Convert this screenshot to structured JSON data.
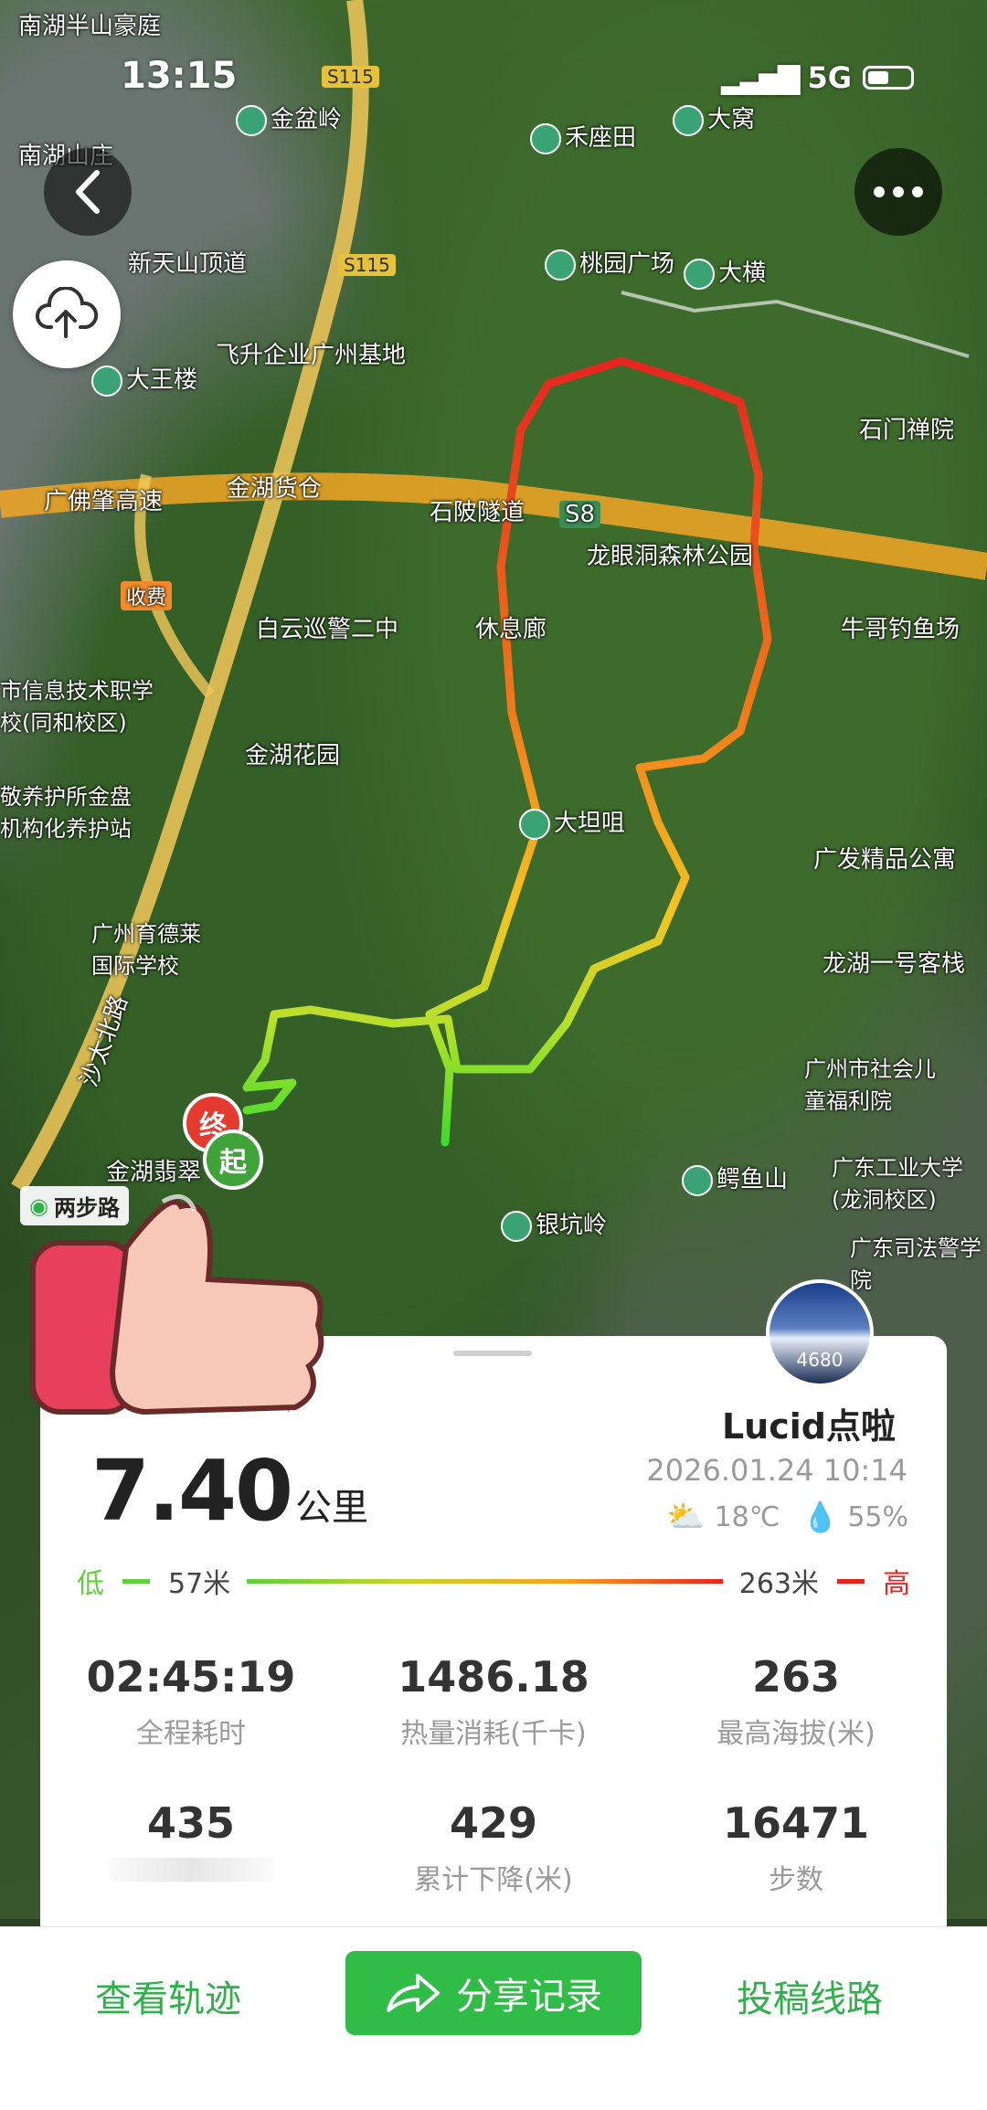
{
  "status_bar": {
    "time": "13:15",
    "network": "5G"
  },
  "map": {
    "route_colors": [
      "#e5261f",
      "#f07a1a",
      "#f4c321",
      "#b6e02a",
      "#3fdc2c"
    ],
    "brand_label": "两步路",
    "start_marker": "起",
    "end_marker": "终",
    "places": [
      "南湖半山豪庭",
      "南湖山庄",
      "金盆岭",
      "禾座田",
      "大窝",
      "新天山顶道",
      "桃园广场",
      "大横",
      "飞升企业广州基地",
      "大王楼",
      "石门禅院",
      "广佛肇高速",
      "金湖货仓",
      "石陂隧道",
      "S8",
      "龙眼洞森林公园",
      "收费",
      "白云巡警二中",
      "休息廊",
      "牛哥钓鱼场",
      "市信息技术职学校(同和校区)",
      "金湖花园",
      "敬养护所金盘机构化养护站",
      "大坦咀",
      "广发精品公寓",
      "广州育德莱国际学校",
      "龙湖一号客栈",
      "沙太北路",
      "广州市社会儿童福利院",
      "金湖翡翠",
      "广东工业大学(龙洞校区)",
      "鳄鱼山",
      "银坑岭",
      "广东司法警学院",
      "S115"
    ]
  },
  "record": {
    "avatar_text": "4680",
    "username": "Lucid点啦",
    "datetime": "2026.01.24 10:14",
    "temperature": "18℃",
    "humidity": "55%",
    "place_partial": "山",
    "distance_value": "7.40",
    "distance_unit": "公里",
    "elevation": {
      "low_label": "低",
      "low_value": "57米",
      "high_value": "263米",
      "high_label": "高"
    },
    "stats": [
      {
        "value": "02:45:19",
        "label": "全程耗时"
      },
      {
        "value": "1486.18",
        "label": "热量消耗(千卡)"
      },
      {
        "value": "263",
        "label": "最高海拔(米)"
      },
      {
        "value": "435",
        "label": ""
      },
      {
        "value": "429",
        "label": "累计下降(米)"
      },
      {
        "value": "16471",
        "label": "步数"
      }
    ]
  },
  "bottom_bar": {
    "view_track": "查看轨迹",
    "share": "分享记录",
    "submit_route": "投稿线路"
  }
}
